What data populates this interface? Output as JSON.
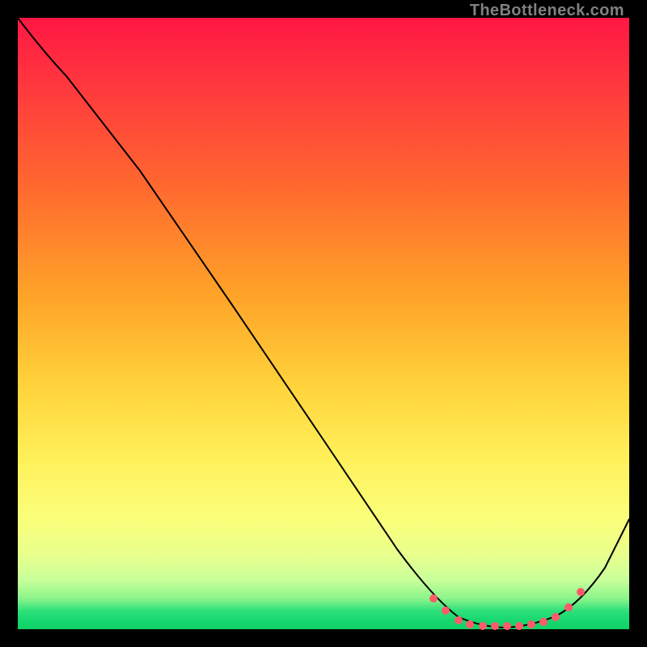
{
  "attribution": "TheBottleneck.com",
  "chart_data": {
    "type": "line",
    "title": "",
    "xlabel": "",
    "ylabel": "",
    "xlim": [
      0,
      100
    ],
    "ylim": [
      0,
      100
    ],
    "series": [
      {
        "name": "bottleneck-curve",
        "x": [
          0,
          8,
          20,
          35,
          50,
          62,
          68,
          72,
          76,
          80,
          84,
          88,
          92,
          100
        ],
        "y": [
          100,
          92,
          75,
          53,
          31,
          13,
          5,
          1.5,
          0.5,
          0.5,
          0.8,
          2,
          6,
          18
        ]
      }
    ],
    "highlight_dots": {
      "name": "valley-dots",
      "color": "#ff5a6a",
      "x": [
        68,
        70,
        72,
        74,
        76,
        78,
        80,
        82,
        84,
        86,
        88,
        90,
        92
      ],
      "y": [
        5,
        3,
        1.5,
        0.8,
        0.5,
        0.5,
        0.5,
        0.6,
        0.8,
        1.2,
        2,
        3.5,
        6
      ]
    }
  }
}
